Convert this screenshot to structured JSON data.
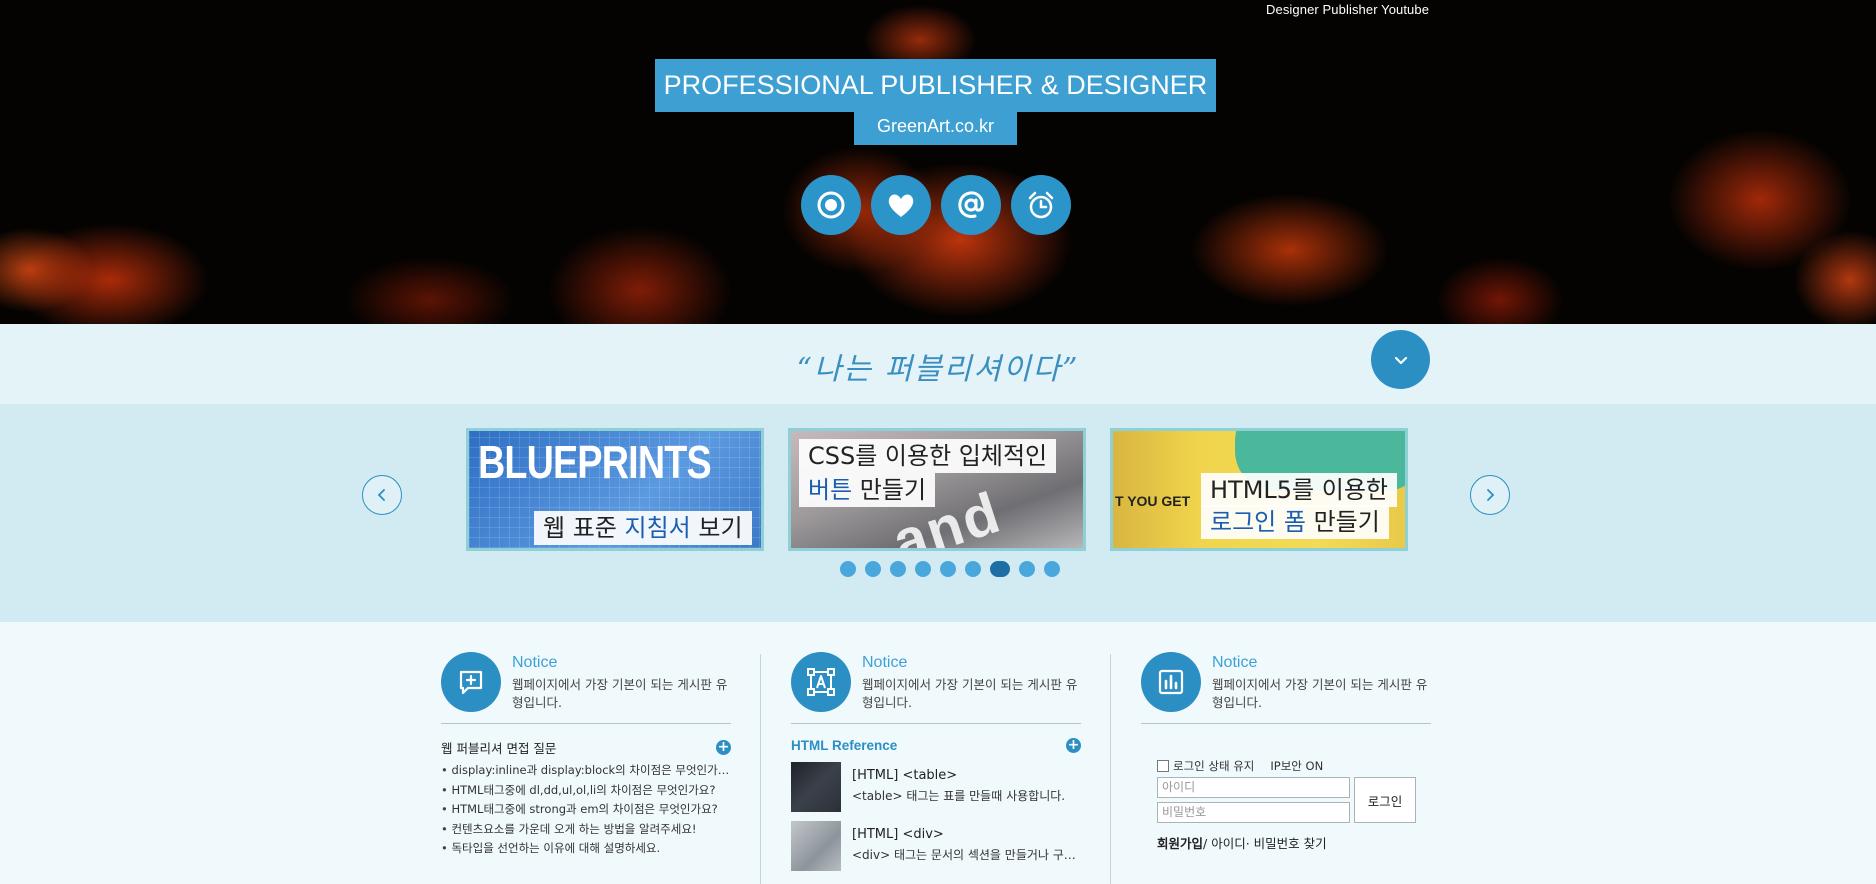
{
  "hero": {
    "top_link": "Designer Publisher Youtube",
    "title": "PROFESSIONAL PUBLISHER & DESIGNER",
    "subtitle": "GreenArt.co.kr",
    "icons": [
      "target-icon",
      "heart-icon",
      "at-icon",
      "alarm-clock-icon"
    ]
  },
  "slogan": {
    "text": "“나는 퍼블리셔이다”"
  },
  "slider": {
    "slides": [
      {
        "big_word": "BLUEPRINTS",
        "caption_pre": "웹 표준 ",
        "caption_hl": "지침서",
        "caption_post": " 보기"
      },
      {
        "bg_text": "and inte",
        "line1": "CSS를 이용한 입체적인",
        "line2_hl": "버튼",
        "line2_post": " 만들기"
      },
      {
        "tiny": "T YOU GET",
        "line1": "HTML5를 이용한",
        "line2_hl": "로그인 폼",
        "line2_post": " 만들기"
      }
    ],
    "dot_count": 9,
    "active_dot": 6
  },
  "columns": [
    {
      "icon": "chat-plus-icon",
      "title": "Notice",
      "desc": "웹페이지에서 가장 기본이 되는 게시판 유형입니다.",
      "list_title": "웹 퍼블리셔 면접 질문",
      "items": [
        "display:inline과 display:block의 차이점은 무엇인가요?",
        "HTML태그중에 dl,dd,ul,ol,li의 차이점은 무엇인가요?",
        "HTML태그중에 strong과 em의 차이점은 무엇인가요?",
        "컨텐츠요소를 가운데 오게 하는 방법을 알려주세요!",
        "독타입을 선언하는 이유에 대해 설명하세요."
      ]
    },
    {
      "icon": "text-box-icon",
      "title": "Notice",
      "desc": "웹페이지에서 가장 기본이 되는 게시판 유형입니다.",
      "ref_title": "HTML Reference",
      "refs": [
        {
          "name": "[HTML] <table>",
          "desc": "<table> 태그는 표를 만들때 사용합니다."
        },
        {
          "name": "[HTML] <div>",
          "desc": "<div> 태그는 문서의 섹션을 만들거나 구분할때 사용합니다."
        }
      ]
    },
    {
      "icon": "bar-chart-icon",
      "title": "Notice",
      "desc": "웹페이지에서 가장 기본이 되는 게시판 유형입니다.",
      "login": {
        "keep_label": "로그인 상태 유지",
        "ip_label": "IP보안 ON",
        "id_placeholder": "아이디",
        "pw_placeholder": "비밀번호",
        "button": "로그인",
        "signup": "회원가입",
        "find": "/ 아이디· 비밀번호 찾기"
      }
    }
  ],
  "colors": {
    "accent": "#3d9fd2",
    "accent_dark": "#2b8fc4",
    "slogan_bg": "#e4f3f8",
    "slider_bg": "#d2ebf2",
    "content_bg": "#f0f9fc"
  }
}
